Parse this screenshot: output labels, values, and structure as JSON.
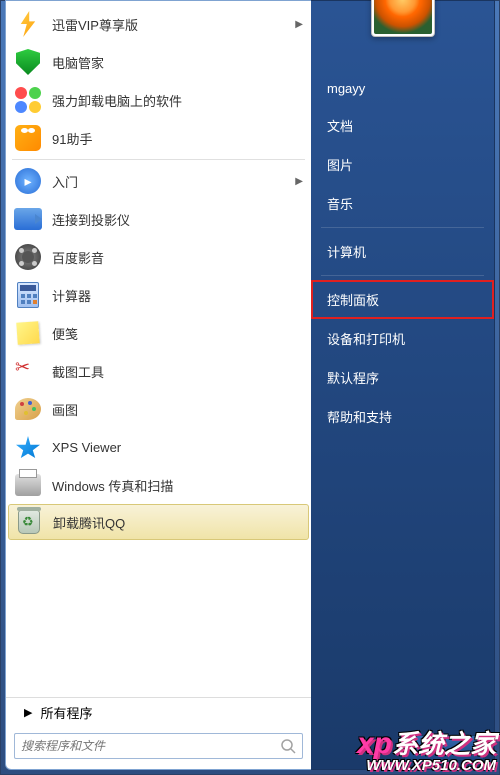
{
  "programs": [
    {
      "label": "迅雷VIP尊享版",
      "has_submenu": true
    },
    {
      "label": "电脑管家",
      "has_submenu": false
    },
    {
      "label": "强力卸载电脑上的软件",
      "has_submenu": false
    },
    {
      "label": "91助手",
      "has_submenu": false
    },
    {
      "label": "入门",
      "has_submenu": true
    },
    {
      "label": "连接到投影仪",
      "has_submenu": false
    },
    {
      "label": "百度影音",
      "has_submenu": false
    },
    {
      "label": "计算器",
      "has_submenu": false
    },
    {
      "label": "便笺",
      "has_submenu": false
    },
    {
      "label": "截图工具",
      "has_submenu": false
    },
    {
      "label": "画图",
      "has_submenu": false
    },
    {
      "label": "XPS Viewer",
      "has_submenu": false
    },
    {
      "label": "Windows 传真和扫描",
      "has_submenu": false
    },
    {
      "label": "卸载腾讯QQ",
      "has_submenu": false
    }
  ],
  "all_programs_label": "所有程序",
  "search_placeholder": "搜索程序和文件",
  "username": "mgayy",
  "right_items": [
    {
      "label": "文档",
      "highlighted": false
    },
    {
      "label": "图片",
      "highlighted": false
    },
    {
      "label": "音乐",
      "highlighted": false
    },
    {
      "label": "计算机",
      "highlighted": false
    },
    {
      "label": "控制面板",
      "highlighted": true
    },
    {
      "label": "设备和打印机",
      "highlighted": false
    },
    {
      "label": "默认程序",
      "highlighted": false
    },
    {
      "label": "帮助和支持",
      "highlighted": false
    }
  ],
  "watermark": {
    "line1": "系统之家",
    "prefix": "xp",
    "url": "WWW.XP510.COM"
  }
}
